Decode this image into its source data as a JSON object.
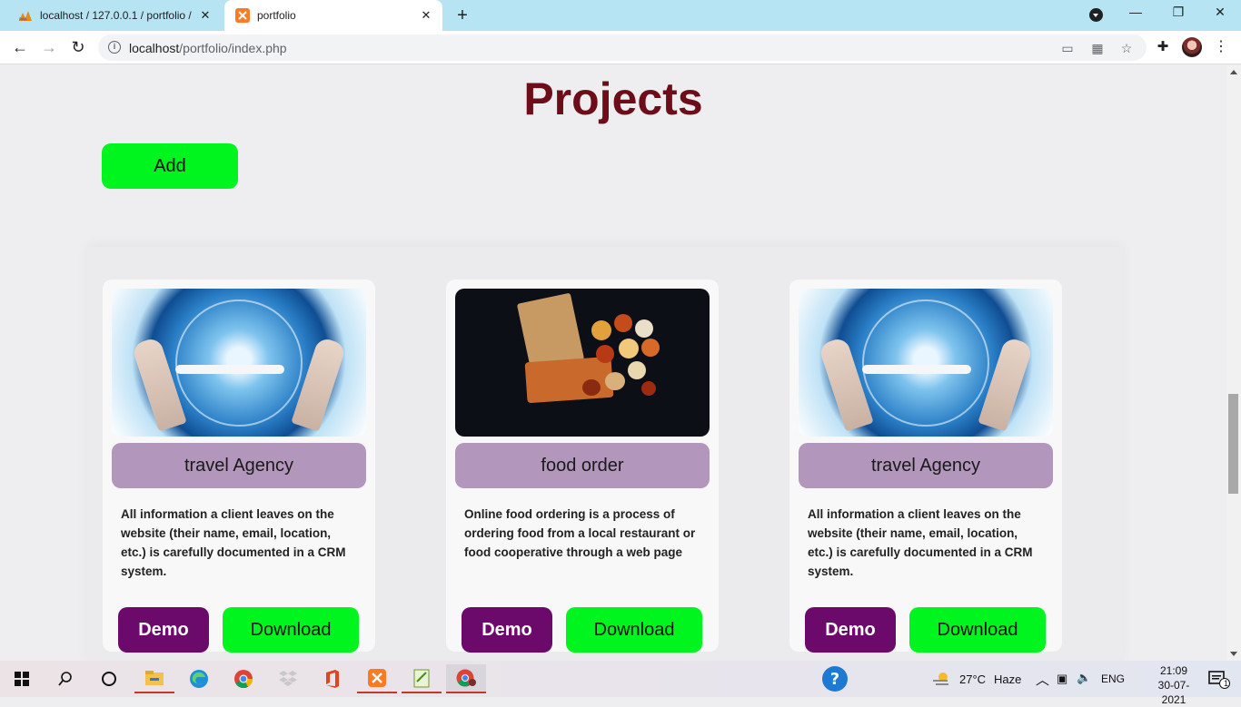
{
  "browser": {
    "tabs": [
      {
        "title": "localhost / 127.0.0.1 / portfolio /",
        "favicon": "phpmyadmin-icon",
        "active": false
      },
      {
        "title": "portfolio",
        "favicon": "xampp-icon",
        "active": true
      }
    ],
    "new_tab_symbol": "+",
    "address": {
      "host": "localhost",
      "path": "/portfolio/index.php"
    },
    "window_controls": {
      "minimize": "—",
      "restore": "❐",
      "close": "✕"
    }
  },
  "page": {
    "title": "Projects",
    "add_label": "Add",
    "projects": [
      {
        "name": "travel Agency",
        "image": "travel-agency-image",
        "description": "All information a client leaves on the website (their name, email, location, etc.) is carefully documented in a CRM system.",
        "demo_label": "Demo",
        "download_label": "Download"
      },
      {
        "name": "food order",
        "image": "food-order-image",
        "description": "Online food ordering is a process of ordering food from a local restaurant or food cooperative through a web page",
        "demo_label": "Demo",
        "download_label": "Download"
      },
      {
        "name": "travel Agency",
        "image": "travel-agency-image",
        "description": "All information a client leaves on the website (their name, email, location, etc.) is carefully documented in a CRM system.",
        "demo_label": "Demo",
        "download_label": "Download"
      }
    ]
  },
  "taskbar": {
    "weather": {
      "temp": "27°C",
      "condition": "Haze"
    },
    "language": "ENG",
    "time": "21:09",
    "date": "30-07-2021",
    "notification_count": "1"
  },
  "colors": {
    "title": "#6e0d1a",
    "add_button": "#00f51f",
    "demo_button": "#6b0a6b",
    "card_label": "#b296bc",
    "tab_strip": "#b6e4f2"
  }
}
